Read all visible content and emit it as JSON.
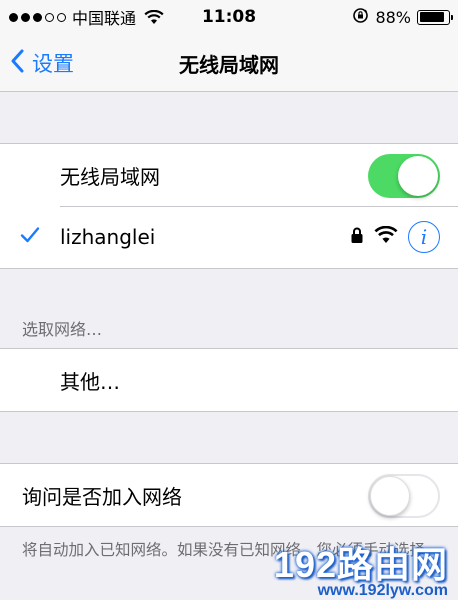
{
  "status_bar": {
    "carrier": "中国联通",
    "time": "11:08",
    "battery_percent": "88%",
    "battery_level": 0.88,
    "signal_bars_filled": 3,
    "signal_bars_total": 5
  },
  "nav": {
    "back_label": "设置",
    "title": "无线局域网"
  },
  "wifi_group": {
    "toggle_label": "无线局域网",
    "toggle_on": true,
    "connected_network": "lizhanglei"
  },
  "choose_section": {
    "header": "选取网络…",
    "other_label": "其他…"
  },
  "ask_group": {
    "label": "询问是否加入网络",
    "toggle_on": false
  },
  "footer": {
    "text": "将自动加入已知网络。如果没有已知网络，您必须手动选择。"
  },
  "watermark": {
    "logo": "192路由网",
    "url": "www.192lyw.com"
  },
  "colors": {
    "accent": "#1a7bff",
    "toggle_on": "#4cd964",
    "background": "#efeff4"
  }
}
